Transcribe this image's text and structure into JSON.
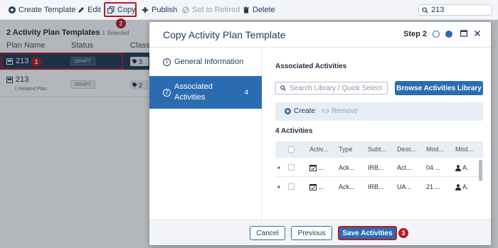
{
  "toolbar": {
    "create_label": "Create Template",
    "edit_label": "Edit",
    "copy_label": "Copy",
    "publish_label": "Publish",
    "retire_label": "Set to Retired",
    "delete_label": "Delete",
    "search_value": "213"
  },
  "callouts": {
    "one": "1",
    "two": "2",
    "three": "3"
  },
  "list": {
    "title": "2 Activity Plan Templates",
    "selected_note": "1 Selected",
    "columns": [
      "Plan Name",
      "Status",
      "Classif"
    ],
    "rows": [
      {
        "name": "213",
        "status": "DRAFT",
        "tag_count": "3",
        "sub": ""
      },
      {
        "name": "213",
        "status": "DRAFT",
        "tag_count": "2",
        "sub": "1 Related Plan"
      }
    ]
  },
  "modal": {
    "title": "Copy Activity Plan Template",
    "step_label": "Step 2",
    "nav": [
      {
        "num": "1",
        "label": "General Information",
        "count": ""
      },
      {
        "num": "2",
        "label_line1": "Associated",
        "label_line2": "Activities",
        "count": "4"
      }
    ],
    "section_title": "Associated Activities",
    "search_placeholder": "Search Library / Quick Select",
    "browse_label": "Browse Activities Library",
    "create_label": "Create",
    "remove_label": "Remove",
    "count_title": "4 Activities",
    "grid_headers": [
      "Activ...",
      "Type",
      "Subt...",
      "Desc...",
      "Mod...",
      "Mod..."
    ],
    "grid_rows": [
      {
        "activity": "...",
        "type": "Ack...",
        "subtype": "IRB...",
        "desc": "Act...",
        "mod_date": "04 ...",
        "mod_by": "A."
      },
      {
        "activity": "...",
        "type": "Ack...",
        "subtype": "IRB...",
        "desc": "UA...",
        "mod_date": "21 ...",
        "mod_by": "A."
      }
    ],
    "cancel_label": "Cancel",
    "previous_label": "Previous",
    "save_label": "Save Activities"
  },
  "colors": {
    "primary": "#2b6cb0",
    "callout": "#b51c24",
    "selected_row": "#243b58",
    "navy_text": "#1f3a5a"
  }
}
